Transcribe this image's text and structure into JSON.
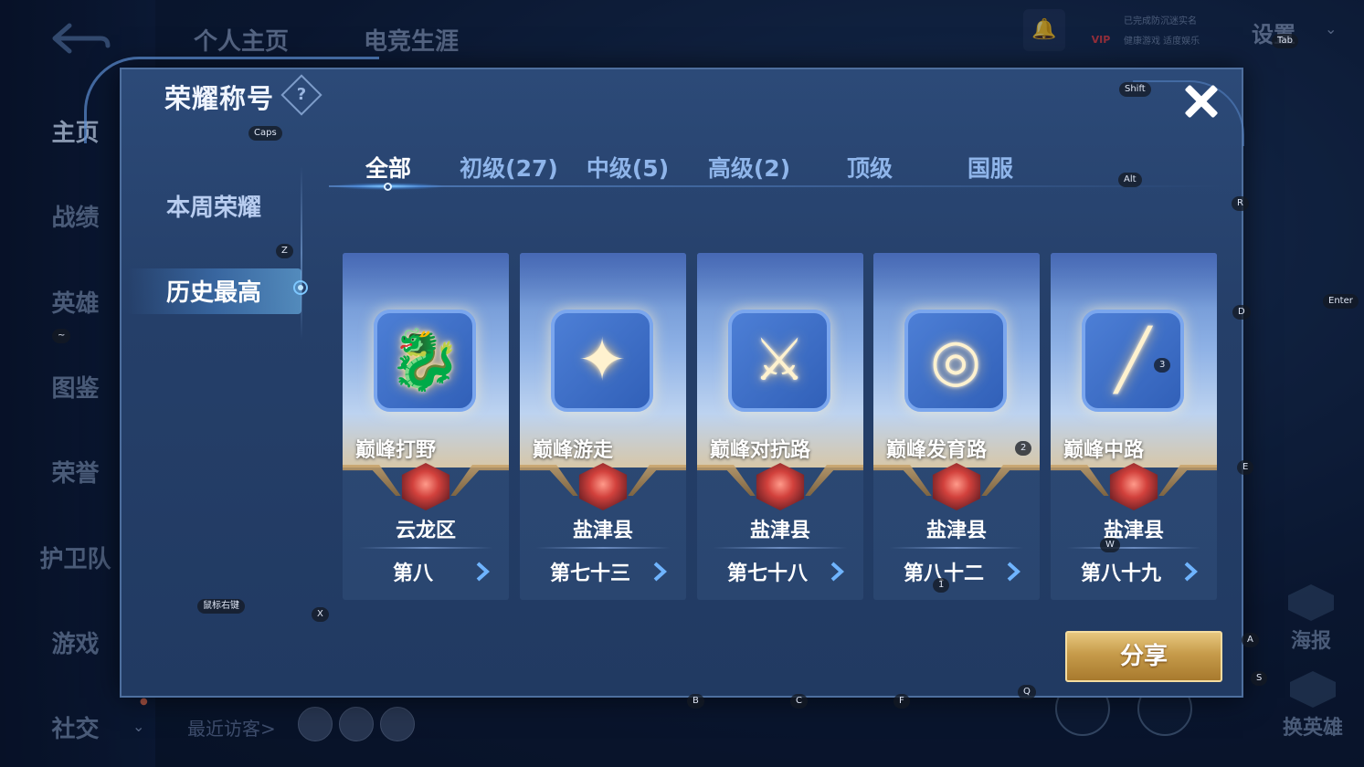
{
  "background": {
    "left_nav": [
      "主页",
      "战绩",
      "英雄",
      "图鉴",
      "荣誉",
      "护卫队",
      "游戏",
      "社交"
    ],
    "top_tabs": [
      "个人主页",
      "电竞生涯"
    ],
    "settings_label": "设置",
    "vip_label": "VIP",
    "vip_text_1": "已完成防沉迷实名",
    "vip_text_2": "健康游戏 适度娱乐",
    "recent_visitors": "最近访客>",
    "poster_label": "海报",
    "change_hero_label": "换英雄"
  },
  "modal": {
    "title": "荣耀称号",
    "help_symbol": "?",
    "sidebar": [
      {
        "label": "本周荣耀",
        "active": false
      },
      {
        "label": "历史最高",
        "active": true
      }
    ],
    "tabs": [
      {
        "label": "全部",
        "active": true
      },
      {
        "label": "初级(27)",
        "active": false
      },
      {
        "label": "中级(5)",
        "active": false
      },
      {
        "label": "高级(2)",
        "active": false
      },
      {
        "label": "顶级",
        "active": false
      },
      {
        "label": "国服",
        "active": false
      }
    ],
    "cards": [
      {
        "name": "巅峰打野",
        "region": "云龙区",
        "rank": "第八",
        "emblem": "dragon-icon",
        "symbol": "🐉"
      },
      {
        "name": "巅峰游走",
        "region": "盐津县",
        "rank": "第七十三",
        "emblem": "wings-icon",
        "symbol": "✦"
      },
      {
        "name": "巅峰对抗路",
        "region": "盐津县",
        "rank": "第七十八",
        "emblem": "crossed-swords-icon",
        "symbol": "⚔"
      },
      {
        "name": "巅峰发育路",
        "region": "盐津县",
        "rank": "第八十二",
        "emblem": "target-icon",
        "symbol": "◎"
      },
      {
        "name": "巅峰中路",
        "region": "盐津县",
        "rank": "第八十九",
        "emblem": "slash-icon",
        "symbol": "╱"
      }
    ],
    "share_label": "分享"
  },
  "key_hints": [
    "Caps",
    "Shift",
    "Tab",
    "Alt",
    "R",
    "Z",
    "D",
    "Enter",
    "E",
    "~",
    "鼠标右键",
    "X",
    "A",
    "S",
    "B",
    "C",
    "F",
    "Q",
    "W",
    "1",
    "2",
    "3"
  ],
  "colors": {
    "accent": "#7ec8ff",
    "share_gold": "#c69b4a",
    "badge_red": "#d2413c"
  }
}
